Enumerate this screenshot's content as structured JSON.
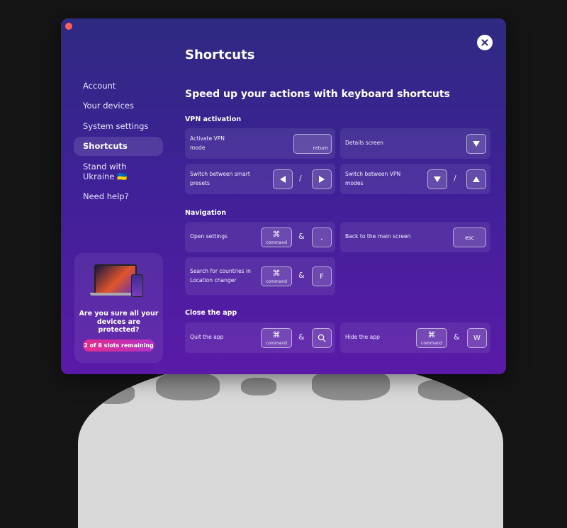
{
  "header": {
    "title": "Shortcuts",
    "subtitle": "Speed up your actions with keyboard shortcuts"
  },
  "sidebar": {
    "items": [
      {
        "label": "Account"
      },
      {
        "label": "Your devices"
      },
      {
        "label": "System settings"
      },
      {
        "label": "Shortcuts",
        "active": true
      },
      {
        "label": "Stand with Ukraine 🇺🇦"
      },
      {
        "label": "Need help?"
      }
    ]
  },
  "promo": {
    "text": "Are you sure all your devices are protected?",
    "badge": "2 of 8 slots remaining"
  },
  "sections": {
    "vpn": {
      "title": "VPN activation",
      "activate_label": "Activate VPN mode",
      "return_key": "return",
      "details_label": "Details screen",
      "presets_label": "Switch between smart presets",
      "modes_label": "Switch between VPN modes",
      "slash": "/"
    },
    "navigation": {
      "title": "Navigation",
      "open_settings_label": "Open settings",
      "comma_key": ",",
      "back_label": "Back to the main screen",
      "esc_key": "esc",
      "search_label": "Search for countries in Location changer",
      "f_key": "F"
    },
    "close": {
      "title": "Close the app",
      "quit_label": "Quit the app",
      "hide_label": "Hide the app",
      "w_key": "W"
    }
  },
  "keys": {
    "command_symbol": "⌘",
    "command_word": "command",
    "and": "&"
  },
  "icons": {
    "close": "close-icon",
    "arrow_down": "arrow-down-icon",
    "arrow_left": "arrow-left-icon",
    "arrow_right": "arrow-right-icon",
    "arrow_up": "arrow-up-icon",
    "search": "search-icon"
  },
  "colors": {
    "accent_badge": "#e62b8c",
    "window_top": "#2f2a82",
    "window_bottom": "#5a1aa8"
  }
}
